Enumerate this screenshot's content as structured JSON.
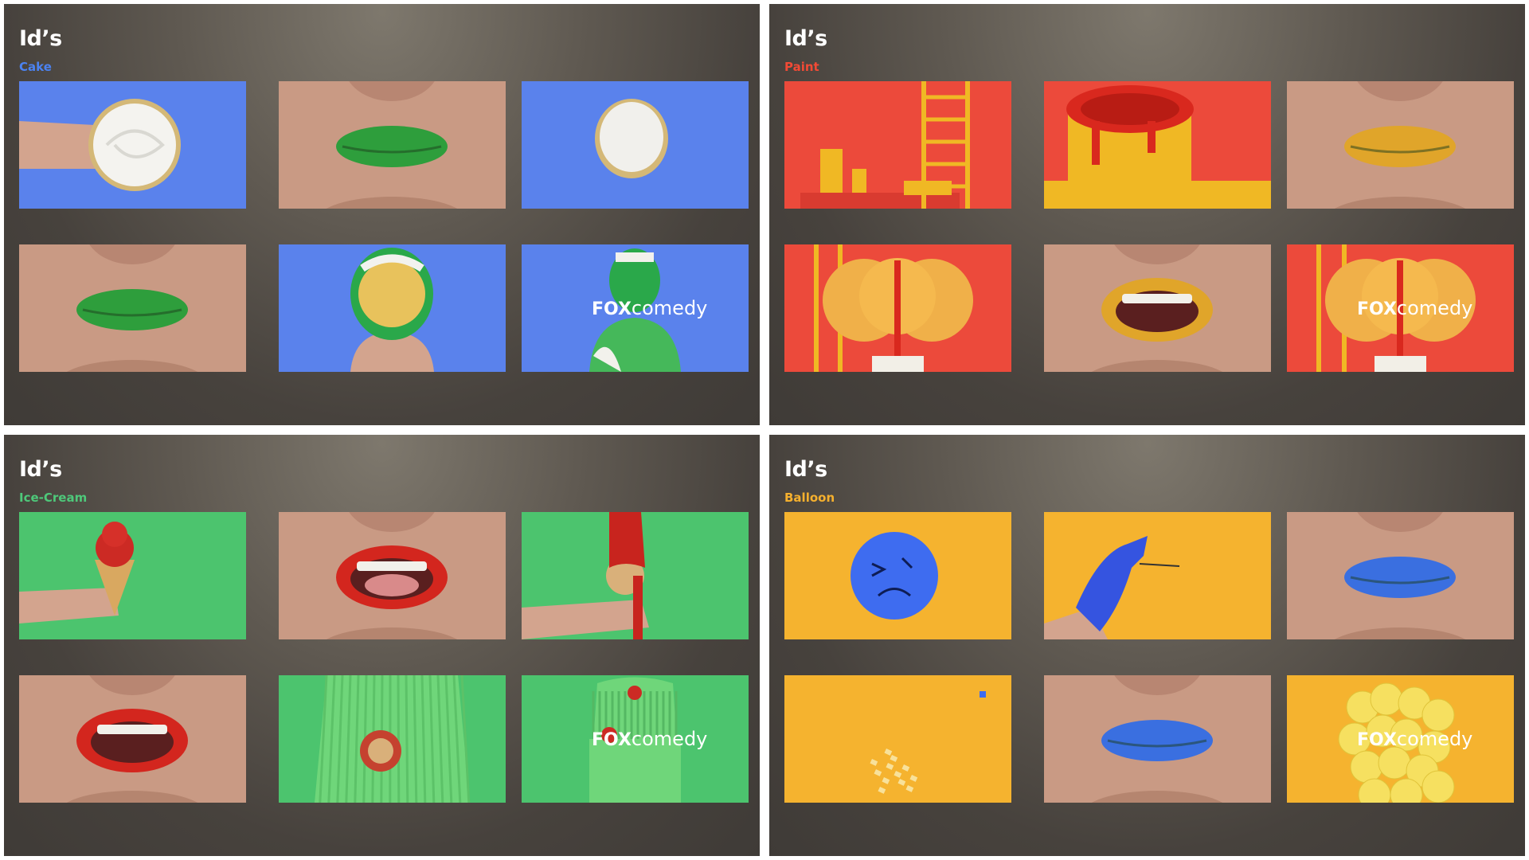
{
  "boards": [
    {
      "title": "Id’s",
      "subtitle": "Cake",
      "subtitle_color": "#4b82f0",
      "background_color": "#5a82ec",
      "frames": [
        {
          "subject": "hand-holding-cream-pie"
        },
        {
          "subject": "green-lips-biting"
        },
        {
          "subject": "cream-pie"
        },
        {
          "subject": "green-lips-biting"
        },
        {
          "subject": "pie-in-face"
        },
        {
          "subject": "cream-covered-figure",
          "logo_text": {
            "bold": "FOX",
            "light": "comedy"
          }
        }
      ]
    },
    {
      "title": "Id’s",
      "subtitle": "Paint",
      "subtitle_color": "#f24a35",
      "background_color": "#ec4a3b",
      "frames": [
        {
          "subject": "paint-cans-and-ladder"
        },
        {
          "subject": "dripping-paint-can"
        },
        {
          "subject": "yellow-lips"
        },
        {
          "subject": "clown-afro-with-ladder"
        },
        {
          "subject": "yellow-lips-open-mouth"
        },
        {
          "subject": "clown-afro",
          "logo_text": {
            "bold": "FOX",
            "light": "comedy"
          }
        }
      ]
    },
    {
      "title": "Id’s",
      "subtitle": "Ice-Cream",
      "subtitle_color": "#4ec87a",
      "background_color": "#4cc46e",
      "frames": [
        {
          "subject": "hand-holding-ice-cream-cone"
        },
        {
          "subject": "red-lips-tongue"
        },
        {
          "subject": "melting-ice-cream-cone"
        },
        {
          "subject": "red-lips-teeth"
        },
        {
          "subject": "green-hair-cone"
        },
        {
          "subject": "green-hair-figure",
          "logo_text": {
            "bold": "FOX",
            "light": "comedy"
          }
        }
      ]
    },
    {
      "title": "Id’s",
      "subtitle": "Balloon",
      "subtitle_color": "#f5b02e",
      "background_color": "#f5b32f",
      "frames": [
        {
          "subject": "blue-sad-face-balloon"
        },
        {
          "subject": "blue-glove-with-needle"
        },
        {
          "subject": "blue-lips-pucker"
        },
        {
          "subject": "balloon-burst-confetti"
        },
        {
          "subject": "blue-lips-biting"
        },
        {
          "subject": "yellow-balloon-cluster",
          "logo_text": {
            "bold": "FOX",
            "light": "comedy"
          }
        }
      ]
    }
  ]
}
